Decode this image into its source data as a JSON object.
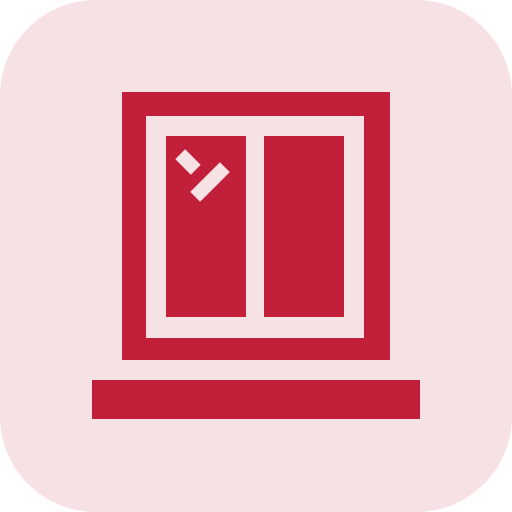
{
  "icon": {
    "name": "window-icon",
    "colors": {
      "background": "#f6e1e5",
      "accent": "#c21f3a"
    }
  }
}
